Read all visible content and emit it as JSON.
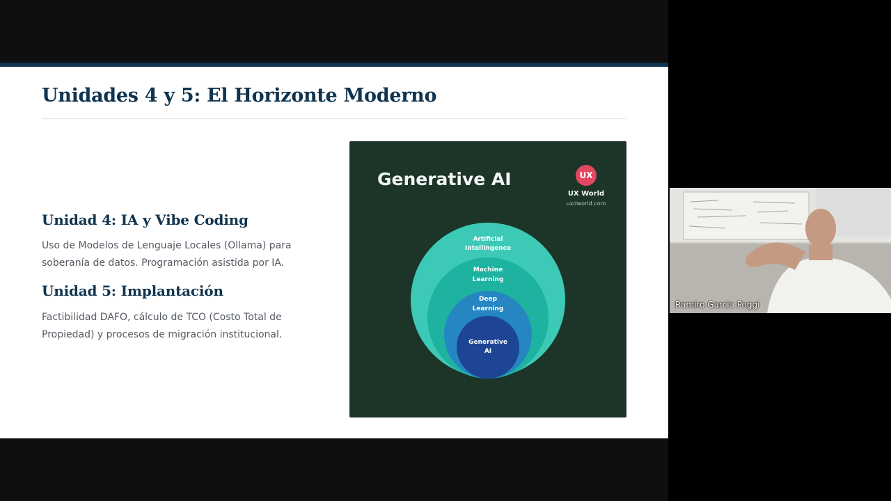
{
  "slide": {
    "title": "Unidades 4 y 5: El Horizonte Moderno",
    "unit4": {
      "heading": "Unidad 4: IA y Vibe Coding",
      "description": "Uso de Modelos de Lenguaje Locales (Ollama) para soberanía de datos. Programación asistida por IA."
    },
    "unit5": {
      "heading": "Unidad 5: Implantación",
      "description": "Factibilidad DAFO, cálculo de TCO (Costo Total de Propiedad) y procesos de migración institucional."
    },
    "image": {
      "title": "Generative AI",
      "badge": "UX",
      "brand": "UX World",
      "url": "uxdworld.com",
      "layers": {
        "l1": [
          "Artificial",
          "Intellingence"
        ],
        "l2": [
          "Machine",
          "Learning"
        ],
        "l3": [
          "Deep",
          "Learning"
        ],
        "l4": [
          "Generative",
          "AI"
        ]
      }
    }
  },
  "participant": {
    "name": "Ramiro Garcia Poggi"
  },
  "colors": {
    "slide_accent": "#10344f",
    "card_background": "#1c3528",
    "badge": "#e2475f"
  }
}
